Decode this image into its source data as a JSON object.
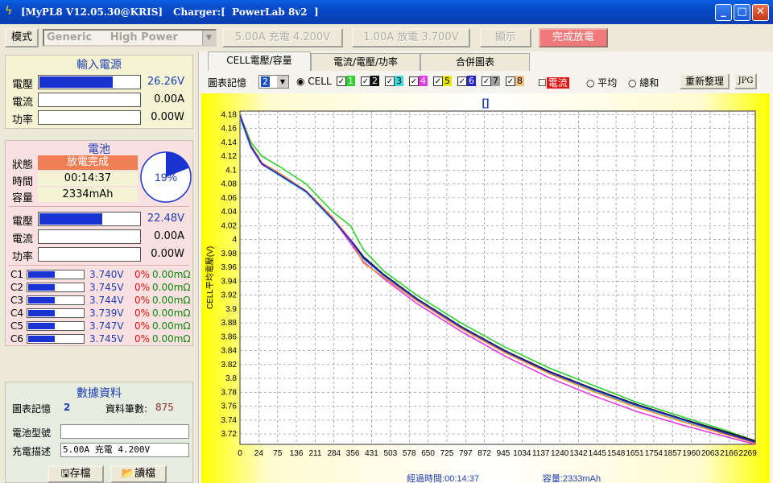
{
  "window": {
    "title": "[MyPL8 V12.05.30@KRIS]",
    "charger": "Charger:[  PowerLab 8v2  ]"
  },
  "toolbar": {
    "mode_label": "模式",
    "mode_value": "Generic     High Power",
    "charge_btn": "5.00A 充電 4.200V",
    "discharge_btn": "1.00A 放電 3.700V",
    "display_btn": "顯示",
    "complete_btn": "完成放電"
  },
  "input_power": {
    "title": "輸入電源",
    "voltage_label": "電壓",
    "voltage": "26.26V",
    "voltage_level": 0.72,
    "current_label": "電流",
    "current": "0.00A",
    "power_label": "功率",
    "power": "0.00W"
  },
  "battery": {
    "title": "電池",
    "status_label": "狀態",
    "status": "放電完成",
    "time_label": "時間",
    "time": "00:14:37",
    "capacity_label": "容量",
    "capacity": "2334mAh",
    "percent": "19%",
    "percent_value": 19,
    "voltage_label": "電壓",
    "voltage": "22.48V",
    "voltage_level": 0.62,
    "current_label": "電流",
    "current": "0.00A",
    "power_label": "功率",
    "power": "0.00W",
    "cells": [
      {
        "name": "C1",
        "voltage": "3.740V",
        "pct": "0%",
        "res": "0.00mΩ",
        "level": 0.47
      },
      {
        "name": "C2",
        "voltage": "3.745V",
        "pct": "0%",
        "res": "0.00mΩ",
        "level": 0.47
      },
      {
        "name": "C3",
        "voltage": "3.744V",
        "pct": "0%",
        "res": "0.00mΩ",
        "level": 0.47
      },
      {
        "name": "C4",
        "voltage": "3.739V",
        "pct": "0%",
        "res": "0.00mΩ",
        "level": 0.47
      },
      {
        "name": "C5",
        "voltage": "3.747V",
        "pct": "0%",
        "res": "0.00mΩ",
        "level": 0.47
      },
      {
        "name": "C6",
        "voltage": "3.745V",
        "pct": "0%",
        "res": "0.00mΩ",
        "level": 0.47
      }
    ]
  },
  "data_panel": {
    "title": "數據資料",
    "chart_memory_label": "圖表記憶",
    "chart_memory_value": "2",
    "record_count_label": "資料筆數:",
    "record_count": "875",
    "battery_model_label": "電池型號",
    "battery_model": "",
    "charge_desc_label": "充電描述",
    "charge_desc": "5.00A 充電 4.200V",
    "save_btn": "存檔",
    "load_btn": "讀檔"
  },
  "tabs": [
    "CELL電壓/容量",
    "電流/電壓/功率",
    "合併圖表"
  ],
  "chart_controls": {
    "memory_label": "圖表記憶",
    "memory_value": "2",
    "cell_label": "CELL",
    "cells": [
      "1",
      "2",
      "3",
      "4",
      "5",
      "6",
      "7",
      "8"
    ],
    "cell_colors": [
      "#2fd02f",
      "#111111",
      "#3cd8d8",
      "#e23be2",
      "#e8e800",
      "#2424c8",
      "#a0a0a0",
      "#f0c080"
    ],
    "current_label": "電流",
    "avg_label": "平均",
    "sum_label": "總和",
    "redraw_btn": "重新整理",
    "jpg_btn": "JPG"
  },
  "chart_data": {
    "type": "line",
    "title": "[]",
    "ylabel": "CELL平均電壓(V)",
    "xlabel": "經過時間:00:14:37",
    "xlabel2": "容量:2333mAh",
    "ylim": [
      3.705,
      4.185
    ],
    "xlim": [
      0,
      2333
    ],
    "y_ticks": [
      "4.18",
      "4.16",
      "4.14",
      "4.12",
      "4.1",
      "4.08",
      "4.06",
      "4.04",
      "4.02",
      "4",
      "3.98",
      "3.96",
      "3.94",
      "3.92",
      "3.9",
      "3.88",
      "3.86",
      "3.84",
      "3.82",
      "3.8",
      "3.78",
      "3.76",
      "3.74",
      "3.72"
    ],
    "x_ticks": [
      "0",
      "24",
      "75",
      "136",
      "211",
      "284",
      "356",
      "431",
      "503",
      "578",
      "650",
      "725",
      "797",
      "872",
      "945",
      "1034",
      "1137",
      "1240",
      "1342",
      "1445",
      "1548",
      "1651",
      "1754",
      "1857",
      "1960",
      "2063",
      "2166",
      "2269"
    ],
    "series": [
      {
        "name": "1",
        "color": "#2fd02f",
        "x": [
          0,
          50,
          100,
          180,
          300,
          420,
          500,
          560,
          650,
          800,
          1000,
          1200,
          1400,
          1600,
          1800,
          2000,
          2200,
          2333
        ],
        "y": [
          4.18,
          4.14,
          4.12,
          4.105,
          4.08,
          4.04,
          4.02,
          3.985,
          3.955,
          3.92,
          3.88,
          3.845,
          3.815,
          3.79,
          3.765,
          3.745,
          3.725,
          3.71
        ]
      },
      {
        "name": "2",
        "color": "#111111",
        "x": [
          0,
          50,
          100,
          180,
          300,
          420,
          500,
          560,
          650,
          800,
          1000,
          1200,
          1400,
          1600,
          1800,
          2000,
          2200,
          2333
        ],
        "y": [
          4.18,
          4.135,
          4.11,
          4.095,
          4.07,
          4.03,
          4.0,
          3.975,
          3.95,
          3.915,
          3.875,
          3.84,
          3.81,
          3.785,
          3.762,
          3.742,
          3.723,
          3.71
        ]
      },
      {
        "name": "3",
        "color": "#3cd8d8",
        "x": [
          0,
          50,
          100,
          180,
          300,
          420,
          500,
          560,
          650,
          800,
          1000,
          1200,
          1400,
          1600,
          1800,
          2000,
          2200,
          2333
        ],
        "y": [
          4.175,
          4.132,
          4.108,
          4.092,
          4.068,
          4.028,
          3.998,
          3.972,
          3.948,
          3.913,
          3.873,
          3.838,
          3.808,
          3.782,
          3.76,
          3.74,
          3.72,
          3.707
        ]
      },
      {
        "name": "4",
        "color": "#e23be2",
        "x": [
          0,
          50,
          100,
          180,
          300,
          420,
          500,
          560,
          650,
          800,
          1000,
          1200,
          1400,
          1600,
          1800,
          2000,
          2200,
          2333
        ],
        "y": [
          4.178,
          4.133,
          4.108,
          4.094,
          4.069,
          4.03,
          3.995,
          3.968,
          3.944,
          3.908,
          3.868,
          3.832,
          3.801,
          3.775,
          3.752,
          3.733,
          3.716,
          3.705
        ]
      },
      {
        "name": "5",
        "color": "#f08c30",
        "x": [
          0,
          50,
          100,
          180,
          300,
          420,
          500,
          560,
          650,
          800,
          1000,
          1200,
          1400,
          1600,
          1800,
          2000,
          2200,
          2333
        ],
        "y": [
          4.18,
          4.136,
          4.11,
          4.095,
          4.07,
          4.032,
          4.0,
          3.966,
          3.946,
          3.912,
          3.872,
          3.837,
          3.807,
          3.781,
          3.758,
          3.738,
          3.719,
          3.707
        ]
      },
      {
        "name": "6",
        "color": "#2424c8",
        "x": [
          0,
          50,
          100,
          180,
          300,
          420,
          500,
          560,
          650,
          800,
          1000,
          1200,
          1400,
          1600,
          1800,
          2000,
          2200,
          2333
        ],
        "y": [
          4.179,
          4.134,
          4.109,
          4.093,
          4.069,
          4.029,
          3.999,
          3.973,
          3.949,
          3.914,
          3.874,
          3.839,
          3.809,
          3.784,
          3.761,
          3.741,
          3.721,
          3.708
        ]
      }
    ]
  }
}
